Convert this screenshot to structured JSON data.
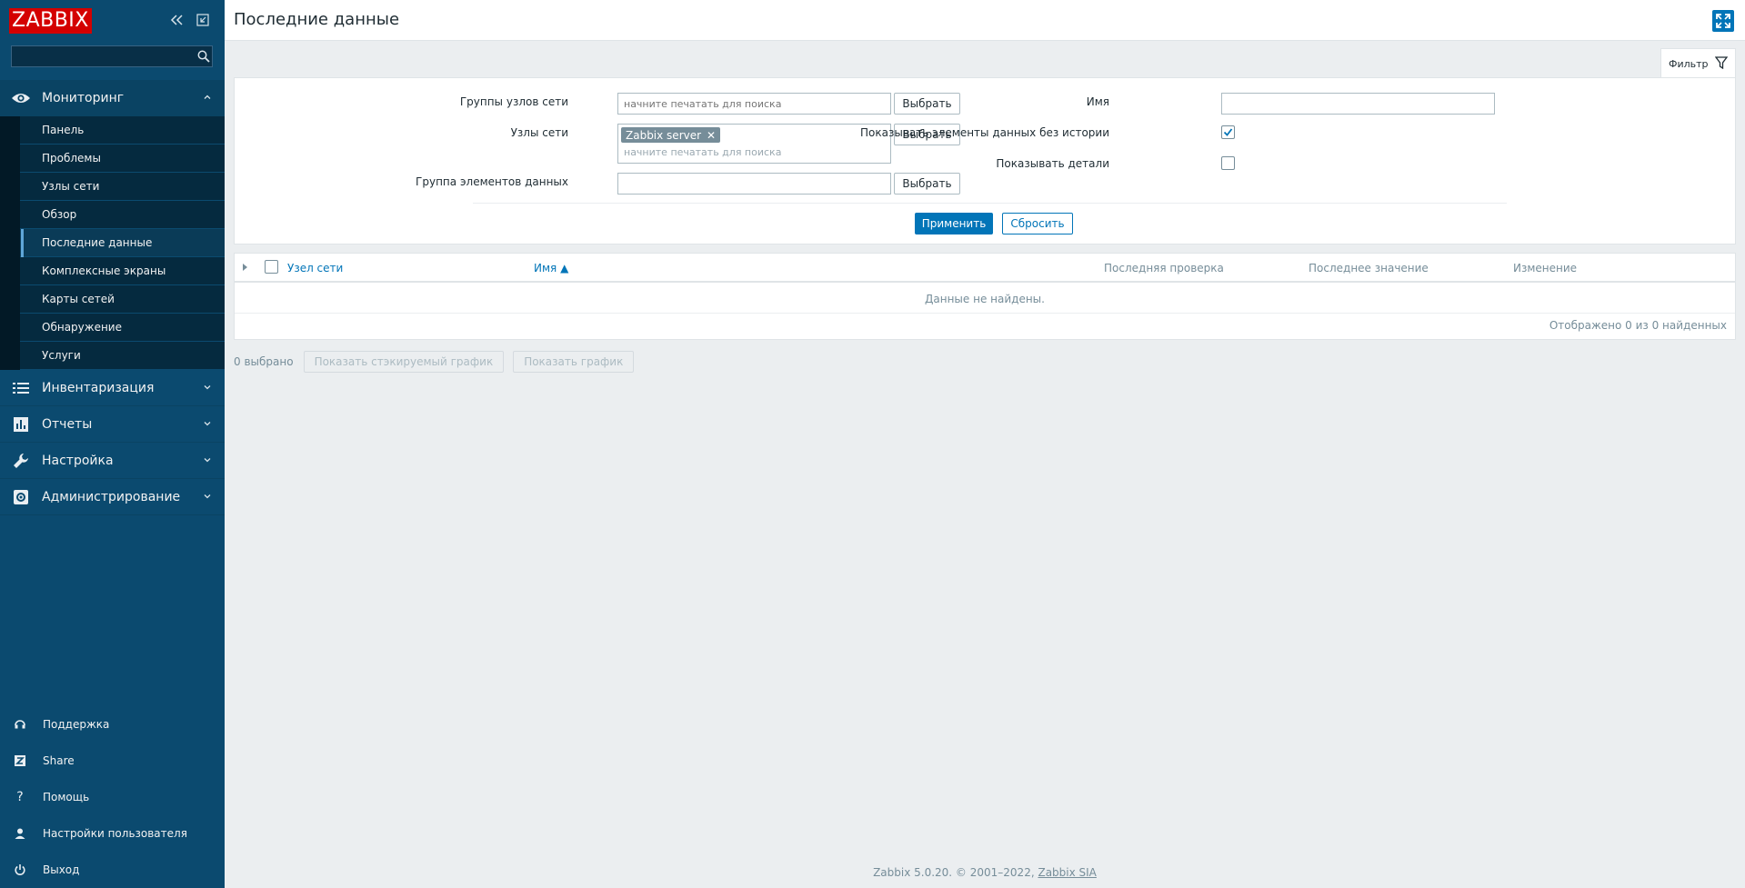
{
  "sidebar": {
    "logo": "ZABBIX",
    "search": {
      "placeholder": "",
      "value": ""
    },
    "sections": [
      {
        "label": "Мониторинг",
        "icon": "eye-icon",
        "expanded": true
      },
      {
        "label": "Инвентаризация",
        "icon": "list-icon"
      },
      {
        "label": "Отчеты",
        "icon": "bar-chart-icon"
      },
      {
        "label": "Настройка",
        "icon": "wrench-icon"
      },
      {
        "label": "Администрирование",
        "icon": "gear-icon"
      }
    ],
    "monitoring_items": [
      {
        "label": "Панель"
      },
      {
        "label": "Проблемы"
      },
      {
        "label": "Узлы сети"
      },
      {
        "label": "Обзор"
      },
      {
        "label": "Последние данные",
        "selected": true
      },
      {
        "label": "Комплексные экраны"
      },
      {
        "label": "Карты сетей"
      },
      {
        "label": "Обнаружение"
      },
      {
        "label": "Услуги"
      }
    ],
    "bottom": [
      {
        "label": "Поддержка",
        "icon": "headset-icon"
      },
      {
        "label": "Share",
        "icon": "share-z-icon"
      },
      {
        "label": "Помощь",
        "icon": "question-icon"
      },
      {
        "label": "Настройки пользователя",
        "icon": "user-icon"
      },
      {
        "label": "Выход",
        "icon": "power-icon"
      }
    ]
  },
  "header": {
    "title": "Последние данные"
  },
  "filter": {
    "tab_label": "Фильтр",
    "host_groups_label": "Группы узлов сети",
    "host_groups_placeholder": "начните печатать для поиска",
    "hosts_label": "Узлы сети",
    "hosts_tag": "Zabbix server",
    "hosts_placeholder": "начните печатать для поиска",
    "app_label": "Группа элементов данных",
    "app_value": "",
    "select_label": "Выбрать",
    "name_label": "Имя",
    "name_value": "",
    "show_without_history_label": "Показывать элементы данных без истории",
    "show_without_history_checked": true,
    "show_details_label": "Показывать детали",
    "show_details_checked": false,
    "apply_label": "Применить",
    "reset_label": "Сбросить"
  },
  "table": {
    "columns": [
      "Узел сети",
      "Имя ▲",
      "Последняя проверка",
      "Последнее значение",
      "Изменение"
    ],
    "empty_message": "Данные не найдены.",
    "footer": "Отображено 0 из 0 найденных"
  },
  "actions": {
    "selected_count": "0 выбрано",
    "stacked_graph": "Показать стэкируемый график",
    "graph": "Показать график"
  },
  "footer": {
    "text": "Zabbix 5.0.20. © 2001–2022,",
    "link": "Zabbix SIA"
  },
  "colors": {
    "sidebar_bg": "#0b4a6f",
    "primary": "#0275b8",
    "logo_red": "#d40000"
  }
}
